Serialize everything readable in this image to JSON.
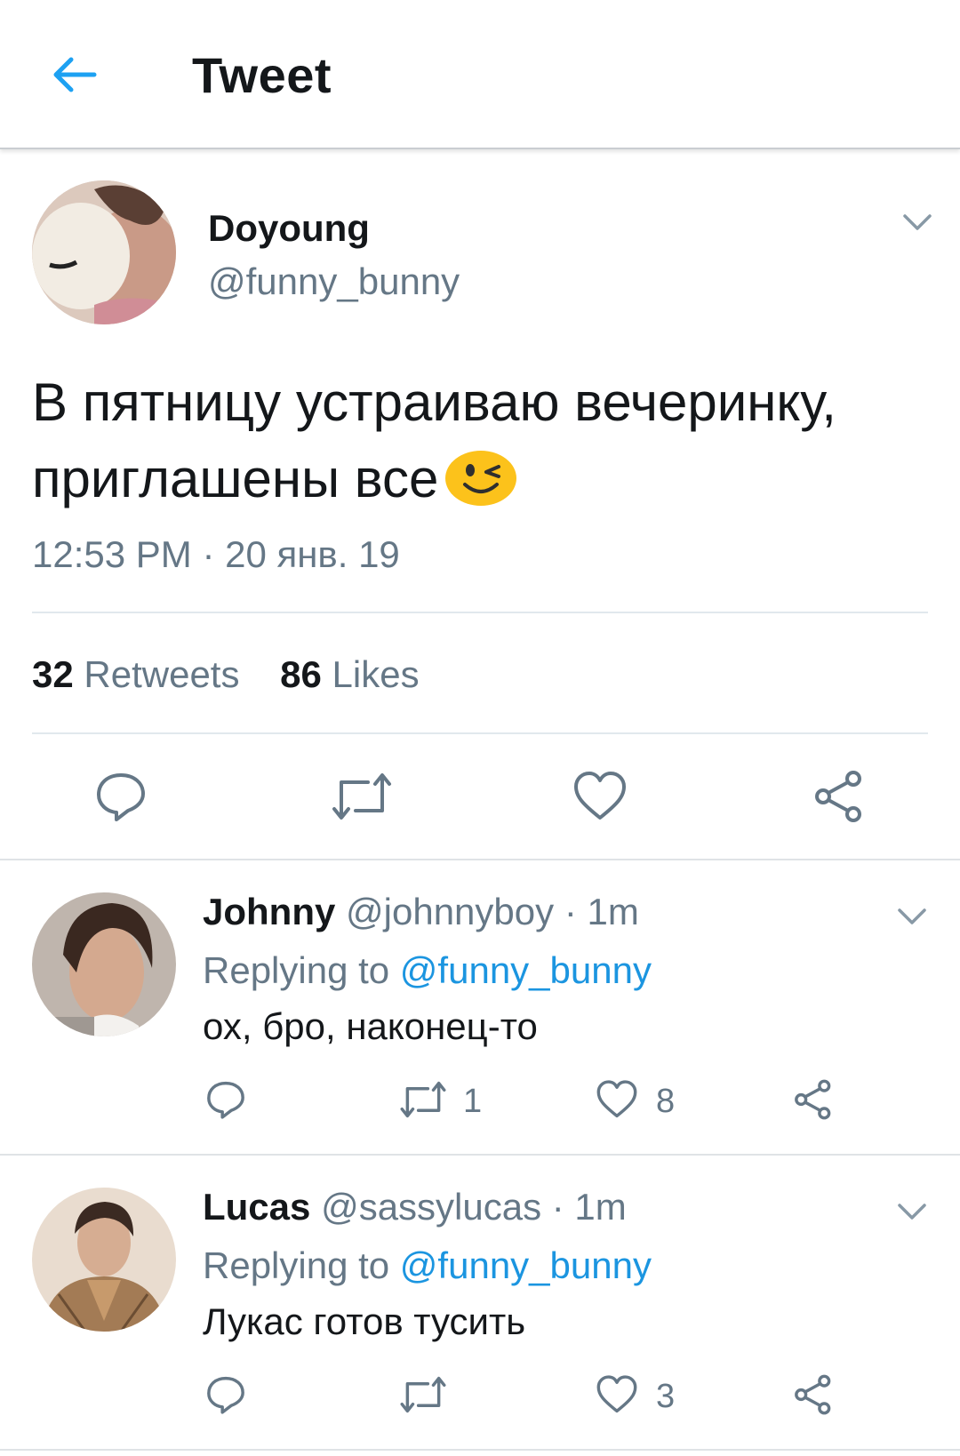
{
  "header": {
    "title": "Tweet",
    "back_icon": "arrow-left-icon",
    "accent": "#1da1f2"
  },
  "tweet": {
    "author_name": "Doyoung",
    "author_handle": "@funny_bunny",
    "text": "В пятницу устраиваю вечеринку, приглашены все",
    "emoji": "winking-face-icon",
    "timestamp": "12:53 PM · 20 янв. 19",
    "retweets_count": "32",
    "retweets_label": "Retweets",
    "likes_count": "86",
    "likes_label": "Likes"
  },
  "replies": [
    {
      "name": "Johnny",
      "handle": "@johnnyboy",
      "time": "· 1m",
      "replying_prefix": "Replying to",
      "replying_to": "@funny_bunny",
      "text": "ох, бро, наконец-то",
      "retweets": "1",
      "likes": "8"
    },
    {
      "name": "Lucas",
      "handle": "@sassylucas",
      "time": "· 1m",
      "replying_prefix": "Replying to",
      "replying_to": "@funny_bunny",
      "text": "Лукас готов тусить",
      "retweets": "",
      "likes": "3"
    }
  ],
  "colors": {
    "text": "#14171a",
    "muted": "#657786",
    "link": "#1b95e0",
    "divider": "#e1e8ed"
  }
}
